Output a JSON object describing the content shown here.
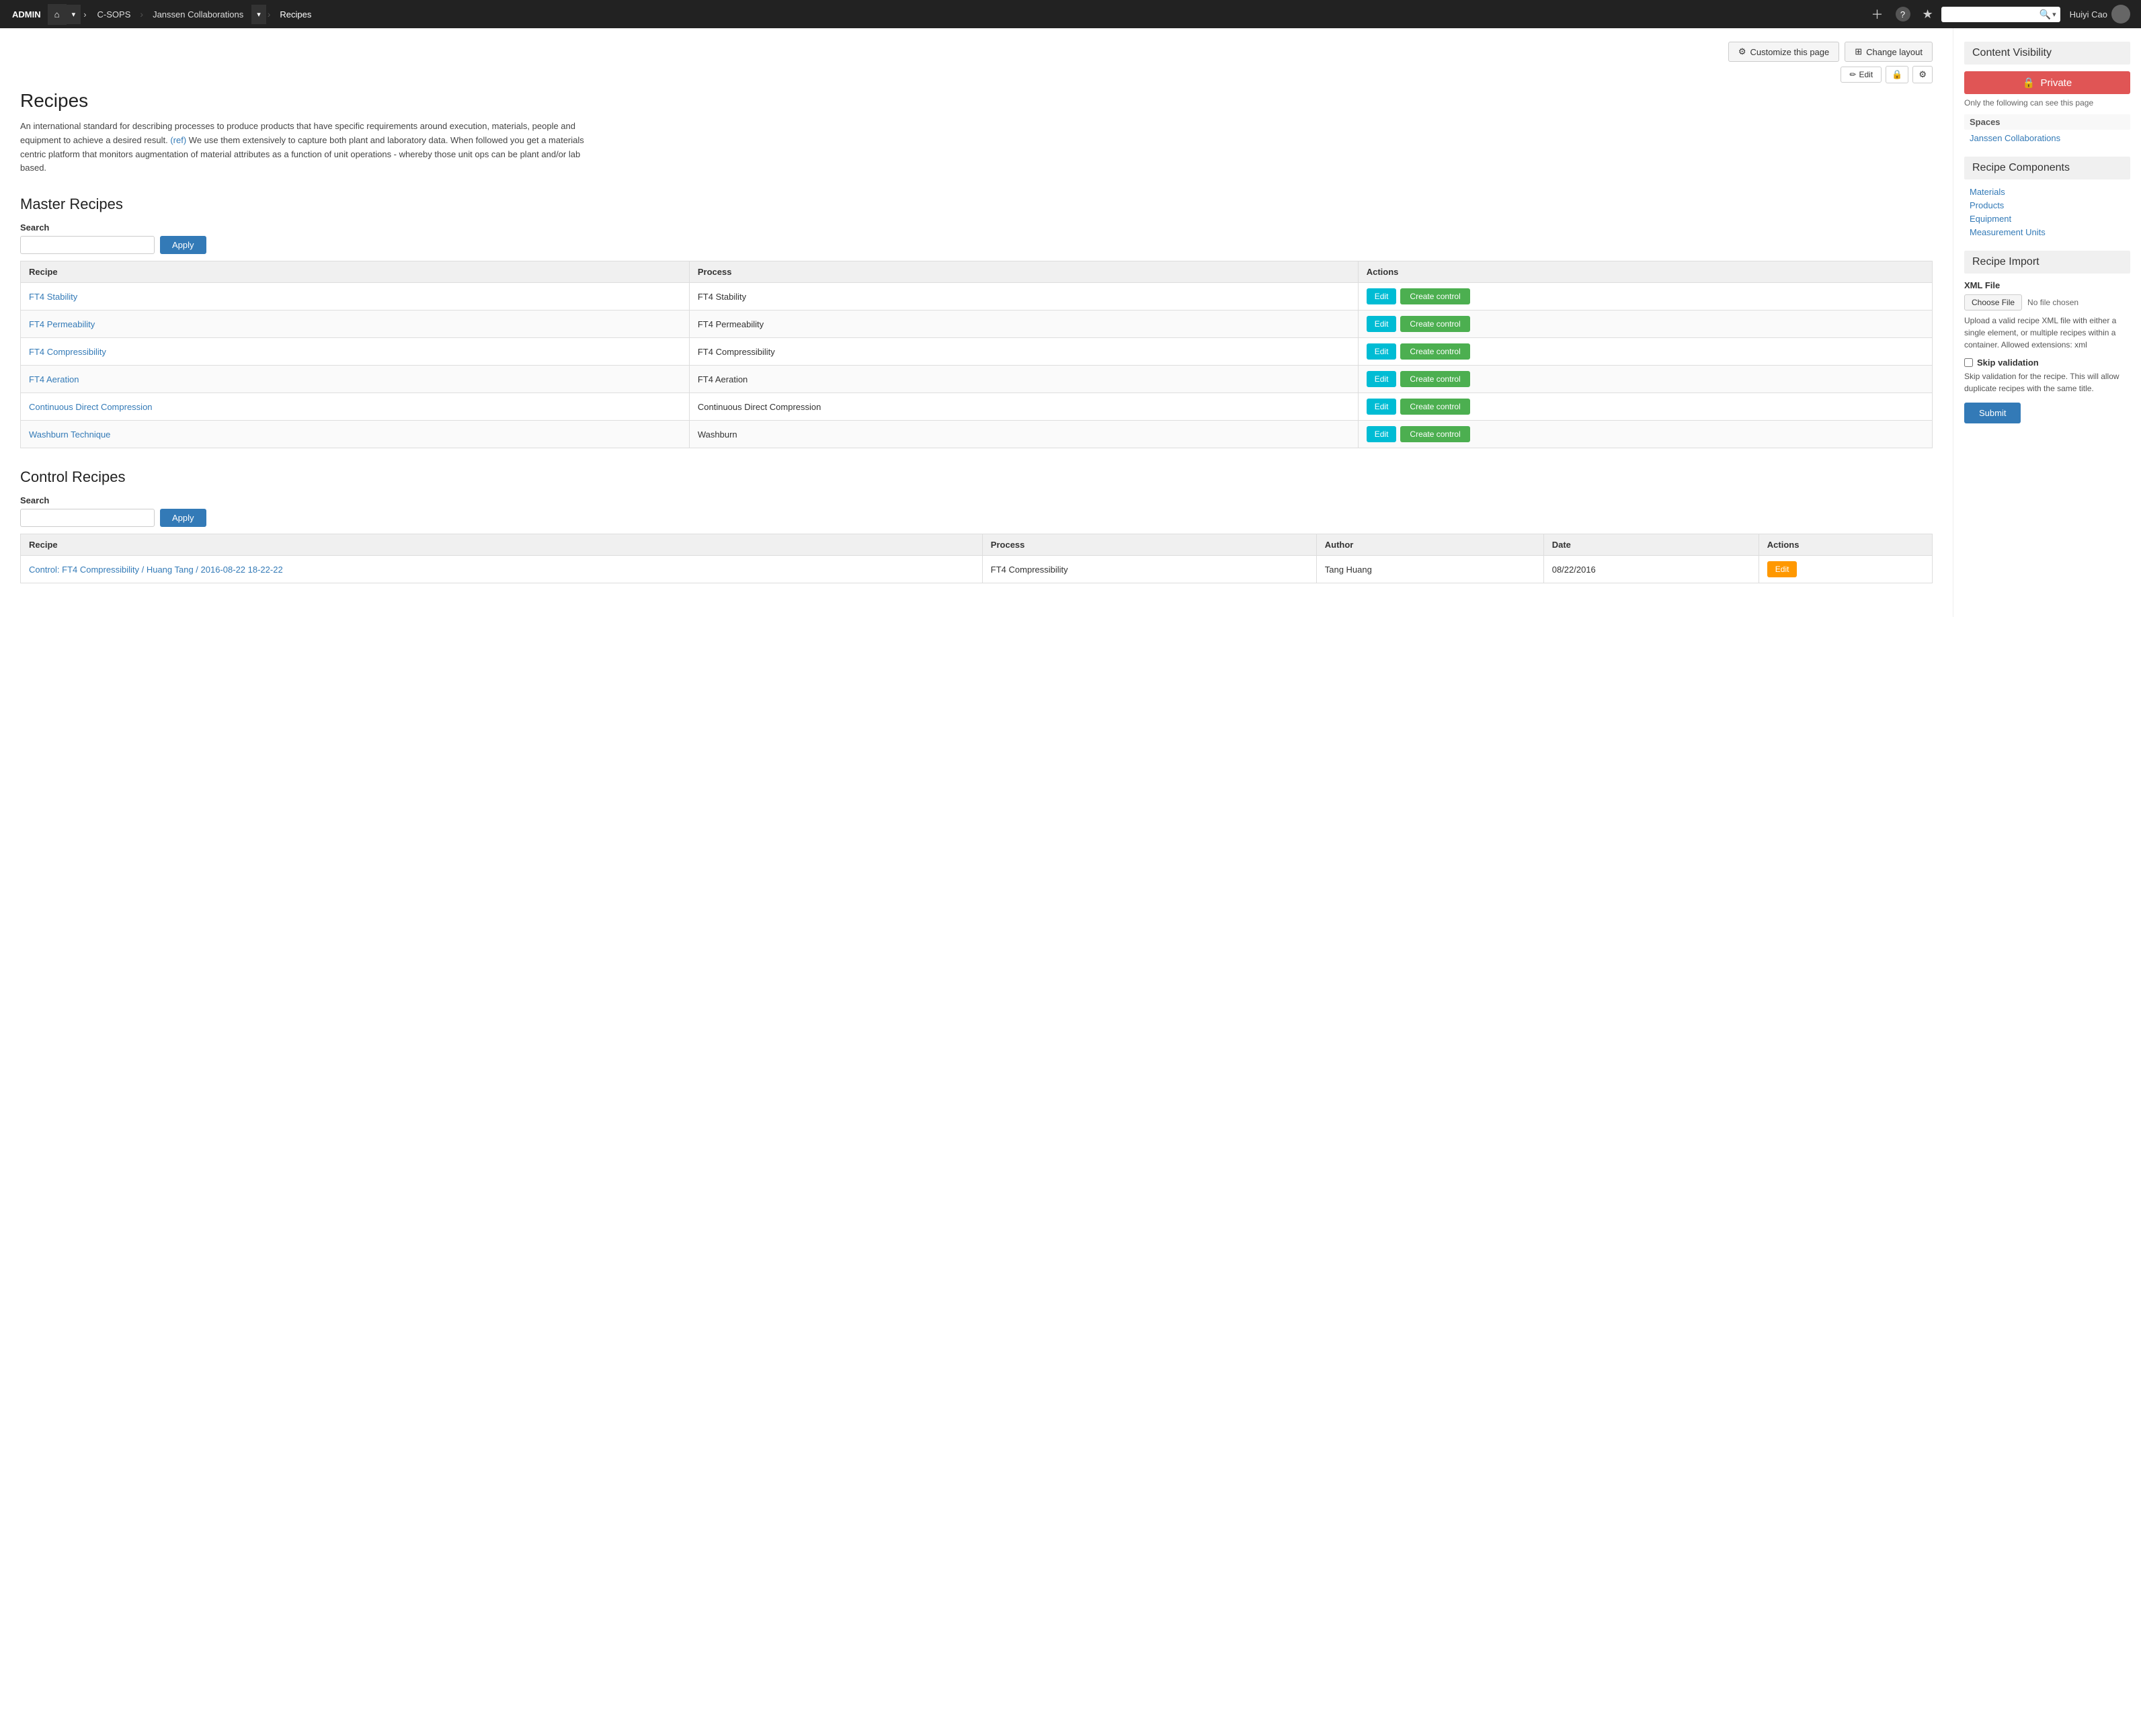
{
  "topnav": {
    "admin_label": "ADMIN",
    "home_icon": "⌂",
    "dropdown_caret": "▾",
    "breadcrumb_csops": "C-SOPS",
    "breadcrumb_janssen": "Janssen Collaborations",
    "breadcrumb_recipes": "Recipes",
    "add_icon": "+",
    "help_icon": "?",
    "star_icon": "★",
    "search_placeholder": "",
    "search_icon": "🔍",
    "search_caret": "▾",
    "user_name": "Huiyi Cao"
  },
  "page_actions": {
    "customize_label": "Customize this page",
    "change_layout_label": "Change layout",
    "edit_label": "Edit",
    "lock_icon": "🔒",
    "settings_icon": "⚙"
  },
  "page": {
    "title": "Recipes",
    "description": "An international standard for describing processes to produce products that have specific requirements around execution, materials, people and equipment to achieve a desired result.",
    "ref": "(ref)",
    "description2": " We use them extensively to capture both plant and laboratory data.  When followed you get a materials centric platform that monitors augmentation of material attributes as a function of unit operations - whereby those unit ops can be plant and/or lab based."
  },
  "master_recipes": {
    "section_title": "Master Recipes",
    "search_label": "Search",
    "search_placeholder": "",
    "apply_label": "Apply",
    "columns": [
      "Recipe",
      "Process",
      "Actions"
    ],
    "rows": [
      {
        "recipe": "FT4 Stability",
        "process": "FT4 Stability"
      },
      {
        "recipe": "FT4 Permeability",
        "process": "FT4 Permeability"
      },
      {
        "recipe": "FT4 Compressibility",
        "process": "FT4 Compressibility"
      },
      {
        "recipe": "FT4 Aeration",
        "process": "FT4 Aeration"
      },
      {
        "recipe": "Continuous Direct Compression",
        "process": "Continuous Direct Compression"
      },
      {
        "recipe": "Washburn Technique",
        "process": "Washburn"
      }
    ],
    "btn_edit": "Edit",
    "btn_create_control": "Create control"
  },
  "control_recipes": {
    "section_title": "Control Recipes",
    "search_label": "Search",
    "search_placeholder": "",
    "apply_label": "Apply",
    "columns": [
      "Recipe",
      "Process",
      "Author",
      "Date",
      "Actions"
    ],
    "rows": [
      {
        "recipe": "Control: FT4 Compressibility / Huang Tang / 2016-08-22 18-22-22",
        "process": "FT4 Compressibility",
        "author": "Tang Huang",
        "date": "08/22/2016"
      }
    ],
    "btn_edit": "Edit"
  },
  "sidebar": {
    "content_visibility": {
      "title": "Content Visibility",
      "private_label": "Private",
      "visibility_note": "Only the following can see this page",
      "spaces_label": "Spaces",
      "spaces_link": "Janssen Collaborations"
    },
    "recipe_components": {
      "title": "Recipe Components",
      "links": [
        "Materials",
        "Products",
        "Equipment",
        "Measurement Units"
      ]
    },
    "recipe_import": {
      "title": "Recipe Import",
      "xml_label": "XML File",
      "choose_file_label": "Choose File",
      "no_file": "No file chosen",
      "import_note": "Upload a valid recipe XML file with either a single element, or multiple recipes within a container. Allowed extensions: xml",
      "skip_label": "Skip validation",
      "skip_note": "Skip validation for the recipe. This will allow duplicate recipes with the same title.",
      "submit_label": "Submit"
    }
  }
}
